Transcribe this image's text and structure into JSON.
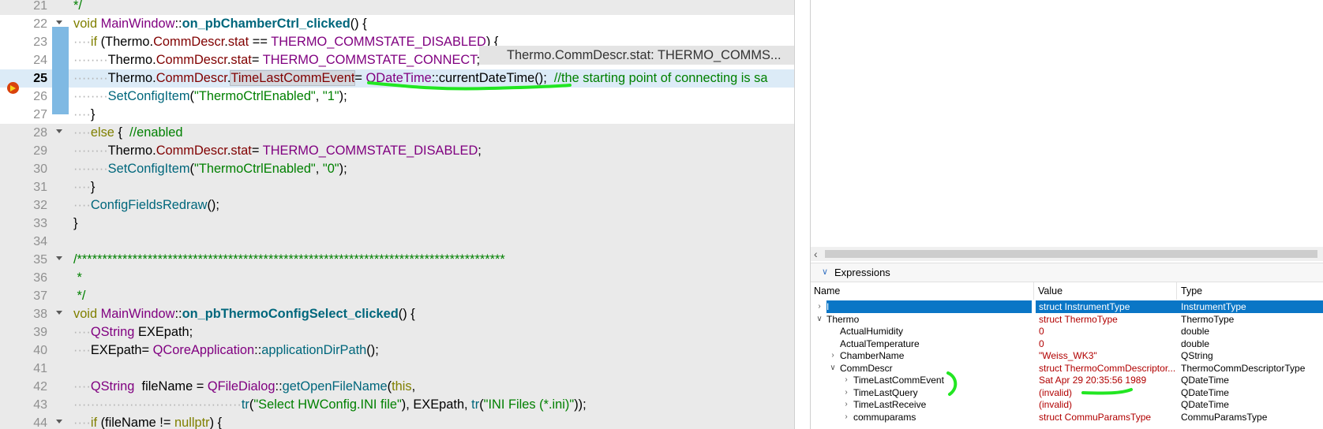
{
  "editor": {
    "lines": [
      {
        "num": "21",
        "bg": "gray",
        "fold": false,
        "html": "<span class=\"cmt\">*/</span>"
      },
      {
        "num": "22",
        "bg": "white",
        "fold": true,
        "html": "<span class=\"kw\">void</span> <span class=\"cls\">MainWindow</span>::<span class=\"fn\">on_pbChamberCtrl_clicked</span>() {"
      },
      {
        "num": "23",
        "bg": "white",
        "fold": true,
        "html": "<span class=\"ind\">····</span><span class=\"kw\">if</span> (Thermo.<span class=\"mem\">CommDescr</span>.<span class=\"mem\">stat</span> == <span class=\"mac\">THERMO_COMMSTATE_DISABLED</span>) {"
      },
      {
        "num": "24",
        "bg": "white",
        "fold": false,
        "html": "<span class=\"ind\">········</span>Thermo.<span class=\"mem\">CommDescr</span>.<span class=\"mem\">stat</span>= <span class=\"mac\">THERMO_COMMSTATE_CONNECT</span>;"
      },
      {
        "num": "25",
        "bg": "cur",
        "fold": false,
        "active": true,
        "html": "<span class=\"ind\">········</span>Thermo.<span class=\"mem\">CommDescr</span>.<span class=\"mem ref\">TimeLastCommEvent</span>= <span class=\"cls\">QDateTime</span>::currentDateTime();<span class=\"cmt\">  //the starting point of connecting is sa</span>"
      },
      {
        "num": "26",
        "bg": "white",
        "fold": false,
        "html": "<span class=\"ind\">········</span><span class=\"fnc\">SetConfigItem</span>(<span class=\"str\">\"ThermoCtrlEnabled\"</span>, <span class=\"str\">\"1\"</span>);"
      },
      {
        "num": "27",
        "bg": "white",
        "fold": false,
        "html": "<span class=\"ind\">····</span>}"
      },
      {
        "num": "28",
        "bg": "gray",
        "fold": true,
        "html": "<span class=\"ind\">····</span><span class=\"kw\">else</span> {<span class=\"cmt\">  //enabled</span>"
      },
      {
        "num": "29",
        "bg": "gray",
        "fold": false,
        "html": "<span class=\"ind\">········</span>Thermo.<span class=\"mem\">CommDescr</span>.<span class=\"mem\">stat</span>= <span class=\"mac\">THERMO_COMMSTATE_DISABLED</span>;"
      },
      {
        "num": "30",
        "bg": "gray",
        "fold": false,
        "html": "<span class=\"ind\">········</span><span class=\"fnc\">SetConfigItem</span>(<span class=\"str\">\"ThermoCtrlEnabled\"</span>, <span class=\"str\">\"0\"</span>);"
      },
      {
        "num": "31",
        "bg": "gray",
        "fold": false,
        "html": "<span class=\"ind\">····</span>}"
      },
      {
        "num": "32",
        "bg": "gray",
        "fold": false,
        "html": "<span class=\"ind\">····</span><span class=\"fnc\">ConfigFieldsRedraw</span>();"
      },
      {
        "num": "33",
        "bg": "gray",
        "fold": false,
        "html": "}"
      },
      {
        "num": "34",
        "bg": "gray",
        "fold": false,
        "html": ""
      },
      {
        "num": "35",
        "bg": "gray",
        "fold": true,
        "html": "<span class=\"cmt\">/*************************************************************************************</span>"
      },
      {
        "num": "36",
        "bg": "gray",
        "fold": false,
        "html": "<span class=\"cmt\"> *</span>"
      },
      {
        "num": "37",
        "bg": "gray",
        "fold": false,
        "html": "<span class=\"cmt\"> */</span>"
      },
      {
        "num": "38",
        "bg": "gray",
        "fold": true,
        "html": "<span class=\"kw\">void</span> <span class=\"cls\">MainWindow</span>::<span class=\"fn\">on_pbThermoConfigSelect_clicked</span>() {"
      },
      {
        "num": "39",
        "bg": "gray",
        "fold": false,
        "html": "<span class=\"ind\">····</span><span class=\"cls\">QString</span> EXEpath;"
      },
      {
        "num": "40",
        "bg": "gray",
        "fold": false,
        "html": "<span class=\"ind\">····</span>EXEpath= <span class=\"cls\">QCoreApplication</span>::<span class=\"fnc\">applicationDirPath</span>();"
      },
      {
        "num": "41",
        "bg": "gray",
        "fold": false,
        "html": ""
      },
      {
        "num": "42",
        "bg": "gray",
        "fold": false,
        "html": "<span class=\"ind\">····</span><span class=\"cls\">QString</span>  fileName = <span class=\"cls\">QFileDialog</span>::<span class=\"fnc\">getOpenFileName</span>(<span class=\"kw\">this</span>,"
      },
      {
        "num": "43",
        "bg": "gray",
        "fold": false,
        "html": "<span class=\"ind\">·······································</span><span class=\"fnc\">tr</span>(<span class=\"str\">\"Select HWConfig.INI file\"</span>), EXEpath, <span class=\"fnc\">tr</span>(<span class=\"str\">\"INI Files (*.ini)\"</span>));"
      },
      {
        "num": "44",
        "bg": "gray",
        "fold": true,
        "html": "<span class=\"ind\">····</span><span class=\"kw\">if</span> (fileName != <span class=\"kw\">nullptr</span>) {"
      }
    ],
    "hover_tooltip": "Thermo.CommDescr.stat: THERMO_COMMS..."
  },
  "expressions": {
    "title": "Expressions",
    "columns": [
      "Name",
      "Value",
      "Type"
    ],
    "rows": [
      {
        "indent": 0,
        "toggle": "collapsed",
        "name": "I",
        "value": "struct InstrumentType",
        "type": "InstrumentType",
        "selected": true
      },
      {
        "indent": 0,
        "toggle": "expanded",
        "name": "Thermo",
        "value": "struct ThermoType",
        "type": "ThermoType"
      },
      {
        "indent": 1,
        "toggle": "none",
        "name": "ActualHumidity",
        "value": "0",
        "type": "double"
      },
      {
        "indent": 1,
        "toggle": "none",
        "name": "ActualTemperature",
        "value": "0",
        "type": "double"
      },
      {
        "indent": 1,
        "toggle": "collapsed",
        "name": "ChamberName",
        "value": "\"Weiss_WK3\"",
        "type": "QString"
      },
      {
        "indent": 1,
        "toggle": "expanded",
        "name": "CommDescr",
        "value": "struct ThermoCommDescriptor...",
        "type": "ThermoCommDescriptorType"
      },
      {
        "indent": 2,
        "toggle": "collapsed",
        "name": "TimeLastCommEvent",
        "value": "Sat Apr 29 20:35:56 1989",
        "type": "QDateTime"
      },
      {
        "indent": 2,
        "toggle": "collapsed",
        "name": "TimeLastQuery",
        "value": "(invalid)",
        "type": "QDateTime"
      },
      {
        "indent": 2,
        "toggle": "collapsed",
        "name": "TimeLastReceive",
        "value": "(invalid)",
        "type": "QDateTime"
      },
      {
        "indent": 2,
        "toggle": "collapsed",
        "name": "commuparams",
        "value": "struct CommuParamsType",
        "type": "CommuParamsType"
      }
    ]
  },
  "colors": {
    "accent_selection": "#0a76c6",
    "annotation_green": "#22e622",
    "value_red": "#b10000",
    "change_bar": "#7fb9e3"
  },
  "icons": {
    "breakpoint": "breakpoint-arrow-icon",
    "tree_collapsed": "chevron-right-icon",
    "tree_expanded": "chevron-down-icon",
    "scroll_left": "scroll-left-arrow-icon"
  }
}
